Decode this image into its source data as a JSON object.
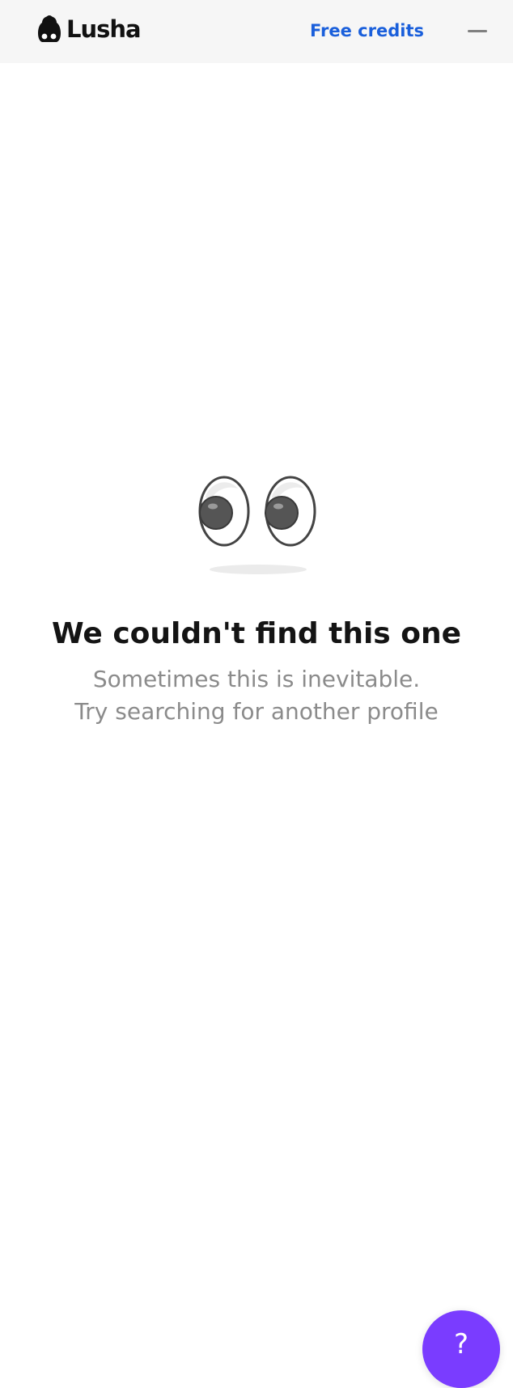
{
  "header": {
    "brand_name": "Lusha",
    "free_credits_label": "Free credits"
  },
  "empty_state": {
    "title": "We couldn't find this one",
    "line1": "Sometimes this is inevitable.",
    "line2": "Try searching for another profile"
  },
  "help": {
    "label": "?"
  },
  "colors": {
    "topbar_bg": "#f6f6f6",
    "link": "#1a5fdb",
    "title": "#141414",
    "subtext": "#8b8b8b",
    "help_button": "#7a3cff"
  },
  "icons": {
    "logo": "lusha-logo-icon",
    "minimize": "minimize-icon",
    "eyes": "eyes-illustration-icon",
    "help": "question-mark-icon"
  }
}
